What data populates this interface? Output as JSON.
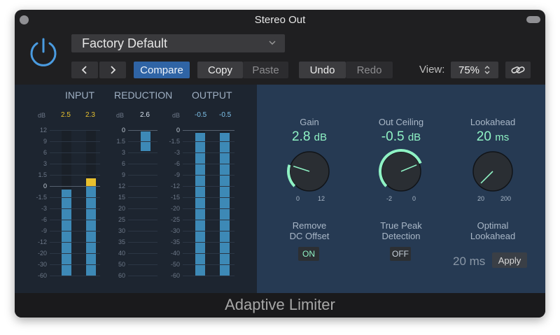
{
  "window": {
    "title": "Stereo Out"
  },
  "header": {
    "preset": "Factory Default",
    "prev": "‹",
    "next": "›",
    "compare": "Compare",
    "copy": "Copy",
    "paste": "Paste",
    "undo": "Undo",
    "redo": "Redo",
    "view_label": "View:",
    "view_value": "75%"
  },
  "meters": {
    "headers": {
      "input": "INPUT",
      "reduction": "REDUCTION",
      "output": "OUTPUT"
    },
    "db_label": "dB",
    "input_scale": [
      "12",
      "9",
      "6",
      "3",
      "1.5",
      "0",
      "-1.5",
      "-3",
      "-6",
      "-9",
      "-12",
      "-20",
      "-30",
      "-60"
    ],
    "reduction_scale": [
      "0",
      "1.5",
      "3",
      "6",
      "9",
      "12",
      "15",
      "20",
      "25",
      "30",
      "35",
      "40",
      "50",
      "60"
    ],
    "output_scale": [
      "0",
      "-1.5",
      "-3",
      "-6",
      "-9",
      "-12",
      "-15",
      "-20",
      "-25",
      "-30",
      "-35",
      "-40",
      "-50",
      "-60"
    ],
    "input_peaks": [
      "2.5",
      "2.3"
    ],
    "reduction_peak": "2.6",
    "output_peaks": [
      "-0.5",
      "-0.5"
    ],
    "input_levels_db": [
      -0.5,
      1.0
    ],
    "input_clip_above_db": 0,
    "reduction_level_db": 2.6,
    "output_levels_db": [
      -0.5,
      -0.5
    ]
  },
  "params": {
    "gain": {
      "label": "Gain",
      "value": "2.8",
      "unit": "dB",
      "min": "0",
      "max": "12",
      "fraction": 0.233
    },
    "ceiling": {
      "label": "Out Ceiling",
      "value": "-0.5",
      "unit": "dB",
      "min": "-2",
      "max": "0",
      "fraction": 0.75
    },
    "lookahead": {
      "label": "Lookahead",
      "value": "20",
      "unit": "ms",
      "min": "20",
      "max": "200",
      "fraction": 0.0
    },
    "dc_offset": {
      "label_line1": "Remove",
      "label_line2": "DC Offset",
      "state": "ON"
    },
    "true_peak": {
      "label_line1": "True Peak",
      "label_line2": "Detection",
      "state": "OFF"
    },
    "optimal": {
      "label_line1": "Optimal",
      "label_line2": "Lookahead",
      "value": "20 ms",
      "apply": "Apply"
    }
  },
  "footer": {
    "plugin_name": "Adaptive Limiter"
  },
  "colors": {
    "accent_blue": "#2f64a5",
    "value_green": "#8ff2c4",
    "meter_blue": "#3d89b6",
    "clip_yellow": "#e8c02e",
    "power_blue": "#4a9be0"
  },
  "icons": [
    "power-icon",
    "chevron-down-icon",
    "chevron-left-icon",
    "chevron-right-icon",
    "stepper-icon",
    "link-icon"
  ]
}
